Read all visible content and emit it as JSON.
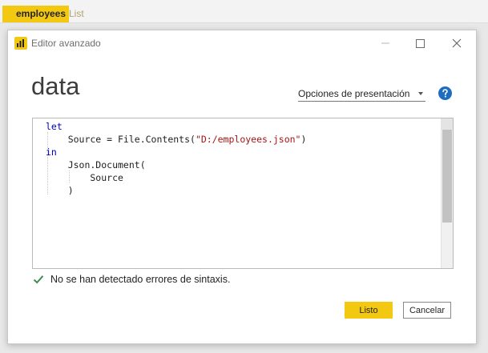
{
  "breadcrumb": {
    "active": "employees",
    "next": "List"
  },
  "dialog": {
    "window_title": "Editor avanzado",
    "heading": "data",
    "display_options_label": "Opciones de presentación",
    "code_lines": [
      "let",
      "    Source = File.Contents(\"D:/employees.json\")",
      "in",
      "    Json.Document(",
      "        Source",
      "    )"
    ],
    "status_text": "No se han detectado errores de sintaxis.",
    "ok_label": "Listo",
    "cancel_label": "Cancelar"
  },
  "colors": {
    "accent": "#f2c811",
    "keyword": "#0000c8",
    "string": "#a31515",
    "success": "#3c8d4f"
  },
  "icons": {
    "app": "power-bi-icon",
    "help": "help-icon",
    "status": "checkmark-icon"
  }
}
